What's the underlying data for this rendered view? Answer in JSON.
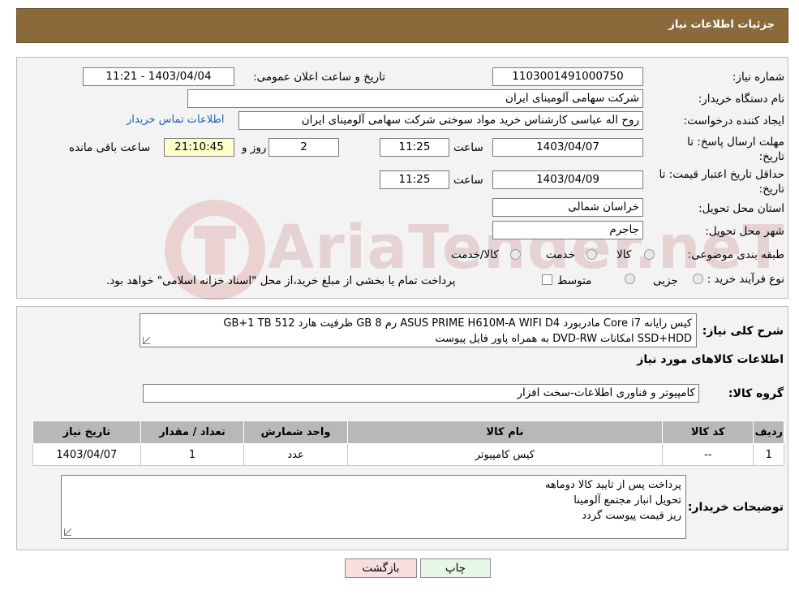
{
  "header": {
    "title": "جزئیات اطلاعات نیاز"
  },
  "form": {
    "need_number": {
      "label": "شماره نیاز:",
      "value": "1103001491000750"
    },
    "announce_datetime": {
      "label": "تاریخ و ساعت اعلان عمومی:",
      "value": "1403/04/04 - 11:21"
    },
    "buyer_org": {
      "label": "نام دستگاه خریدار:",
      "value": "شرکت سهامی آلومینای ایران"
    },
    "requester": {
      "label": "ایجاد کننده درخواست:",
      "value": "روح اله عباسی کارشناس خرید مواد سوختی شرکت سهامی آلومینای ایران",
      "contact_link": "اطلاعات تماس خریدار"
    },
    "reply_deadline": {
      "label": "مهلت ارسال پاسخ: تا تاریخ:",
      "date": "1403/04/07",
      "time_label": "ساعت",
      "time": "11:25",
      "days": "2",
      "days_label": "روز و",
      "remaining": "21:10:45",
      "remaining_label": "ساعت باقی مانده"
    },
    "price_validity": {
      "label": "حداقل تاریخ اعتبار قیمت: تا تاریخ:",
      "date": "1403/04/09",
      "time_label": "ساعت",
      "time": "11:25"
    },
    "province": {
      "label": "استان محل تحویل:",
      "value": "خراسان شمالی"
    },
    "city": {
      "label": "شهر محل تحویل:",
      "value": "جاجرم"
    },
    "category": {
      "label": "طبقه بندی موضوعی:",
      "options": [
        "کالا",
        "خدمت",
        "کالا/خدمت"
      ]
    },
    "purchase_type": {
      "label": "نوع فرآیند خرید :",
      "options": [
        "جزیی",
        "متوسط"
      ],
      "note": "پرداخت تمام یا بخشی از مبلغ خرید،از محل \"اسناد خزانه اسلامی\" خواهد بود."
    }
  },
  "summary": {
    "label": "شرح کلی نیاز:",
    "line1": "کیس رایانه Core i7 مادربورد ASUS PRIME H610M-A WIFI D4 رم 8 GB ظرفیت هارد 512 GB+1 TB",
    "line2": "SSD+HDD امکانات DVD-RW به همراه پاور فایل پیوست",
    "goods_info_title": "اطلاعات کالاهای مورد نیاز",
    "goods_group_label": "گروه کالا:",
    "goods_group_value": "کامپیوتر و فناوری اطلاعات-سخت افزار"
  },
  "table": {
    "headers": [
      "ردیف",
      "کد کالا",
      "نام کالا",
      "واحد شمارش",
      "تعداد / مقدار",
      "تاریخ نیاز"
    ],
    "rows": [
      [
        "1",
        "--",
        "کیس کامپیوتر",
        "عدد",
        "1",
        "1403/04/07"
      ]
    ]
  },
  "buyer_notes": {
    "label": "توضیحات خریدار:",
    "lines": [
      "پرداخت پس از تایید کالا دوماهه",
      "تحویل انبار مجتمع آلومینا",
      "ریز قیمت پیوست گردد"
    ]
  },
  "buttons": {
    "print": "چاپ",
    "back": "بازگشت"
  },
  "watermark": {
    "text": "AriaTender.neT"
  },
  "colors": {
    "header_bg": "#8a6a3a",
    "panel_bg": "#f3f3f3",
    "link": "#1f5fb0",
    "table_header": "#b8b8b8",
    "back_button": "#f8dede",
    "print_button": "#e6f7e6"
  }
}
